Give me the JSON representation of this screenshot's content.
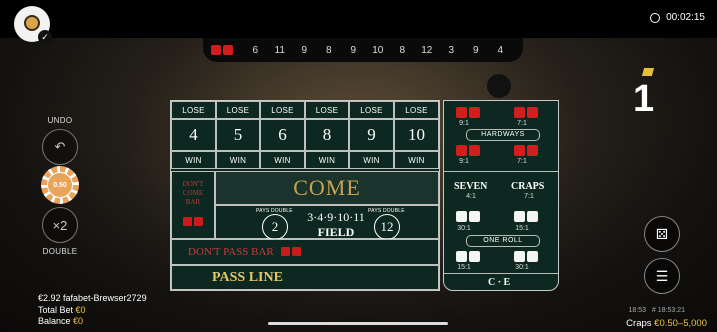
{
  "header": {
    "timer": "00:02:15"
  },
  "history": {
    "numbers": [
      "6",
      "11",
      "9",
      "8",
      "9",
      "10",
      "8",
      "12",
      "3",
      "9",
      "4"
    ]
  },
  "point": {
    "value": "1"
  },
  "left_controls": {
    "undo_label": "UNDO",
    "chip_value": "0.50",
    "double_symbol": "×2",
    "double_label": "DOUBLE"
  },
  "table": {
    "lose_label": "LOSE",
    "win_label": "WIN",
    "place_numbers": [
      "4",
      "5",
      "6",
      "8",
      "9",
      "10"
    ],
    "dont_come_bar": "DON'T COME BAR",
    "come": "COME",
    "field_numbers": "3·4·9·10·11",
    "field": "FIELD",
    "pays_double": "PAYS DOUBLE",
    "field_two": "2",
    "field_twelve": "12",
    "dont_pass_bar": "DON'T PASS BAR",
    "pass_line": "PASS LINE"
  },
  "props": {
    "hardways": "HARDWAYS",
    "hard_odds": [
      "9:1",
      "7:1",
      "9:1",
      "7:1"
    ],
    "seven": "SEVEN",
    "seven_odds": "4:1",
    "craps": "CRAPS",
    "craps_odds": "7:1",
    "horn_odds": [
      "30:1",
      "15:1",
      "15:1",
      "30:1"
    ],
    "one_roll": "ONE ROLL",
    "ce": "C · E"
  },
  "bottom": {
    "balance_line": "€2.92 fafabet-Brewser2729",
    "total_bet_label": "Total Bet",
    "total_bet_value": "€0",
    "balance_label": "Balance",
    "balance_value": "€0",
    "time": "18:53",
    "round_id": "# 18:53:21",
    "game_label": "Craps",
    "limits": "€0.50–5,000"
  },
  "colors": {
    "accent": "#f0c14b",
    "felt": "#0c2820",
    "red": "#d11f1f"
  }
}
